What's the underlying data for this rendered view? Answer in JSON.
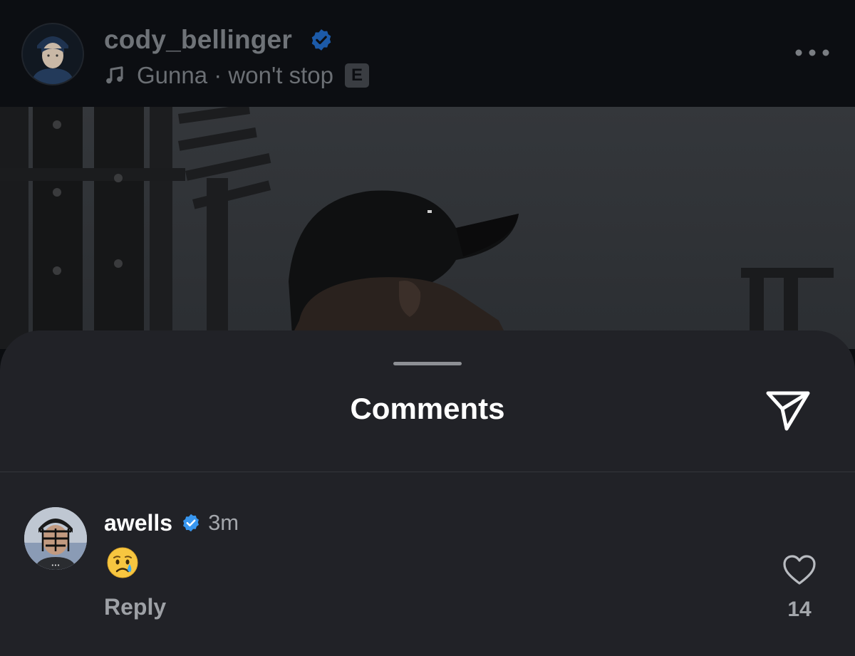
{
  "post": {
    "username": "cody_bellinger",
    "verified": true,
    "music": {
      "icon": "music-note-icon",
      "text": "Gunna · won't stop",
      "explicit_label": "E"
    },
    "more_icon": "more-horizontal-icon"
  },
  "comments_sheet": {
    "title": "Comments",
    "share_icon": "send-icon",
    "comments": [
      {
        "username": "awells",
        "verified": true,
        "time": "3m",
        "text_emoji": "crying-face-emoji",
        "reply_label": "Reply",
        "like_icon": "heart-outline-icon",
        "like_count": "14"
      }
    ]
  },
  "colors": {
    "verified_blue": "#3897f0",
    "sheet_background": "#212227",
    "header_background": "#0c0e12"
  }
}
